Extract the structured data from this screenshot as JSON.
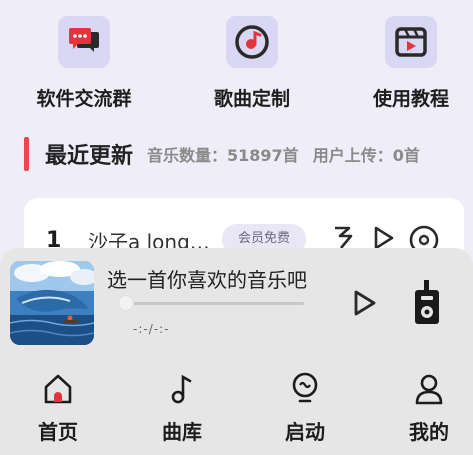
{
  "quick_actions": [
    {
      "label": "软件交流群",
      "icon": "chat-bubbles-icon"
    },
    {
      "label": "歌曲定制",
      "icon": "music-disc-icon"
    },
    {
      "label": "使用教程",
      "icon": "video-clapper-icon"
    }
  ],
  "recent": {
    "title": "最近更新",
    "music_count": "音乐数量：51897首",
    "user_uploads": "用户上传：0首"
  },
  "song_card": {
    "rank": "1",
    "title": "沙子a long ...",
    "badge": "会员免费",
    "icons": [
      "lyrics-icon",
      "play-icon",
      "download-disc-icon"
    ]
  },
  "player": {
    "prompt": "选一首你喜欢的音乐吧",
    "time": "-:-/-:-",
    "progress": 0,
    "icons": [
      "album-cover",
      "play-icon",
      "radio-icon"
    ]
  },
  "tabs": [
    {
      "label": "首页",
      "icon": "home-icon"
    },
    {
      "label": "曲库",
      "icon": "music-note-icon"
    },
    {
      "label": "启动",
      "icon": "lightbulb-icon"
    },
    {
      "label": "我的",
      "icon": "user-icon"
    }
  ],
  "colors": {
    "background": "#efedf8",
    "accent_red": "#ec4550",
    "icon_tile": "#d9d7f3",
    "player_bg": "#e6e6e6"
  }
}
